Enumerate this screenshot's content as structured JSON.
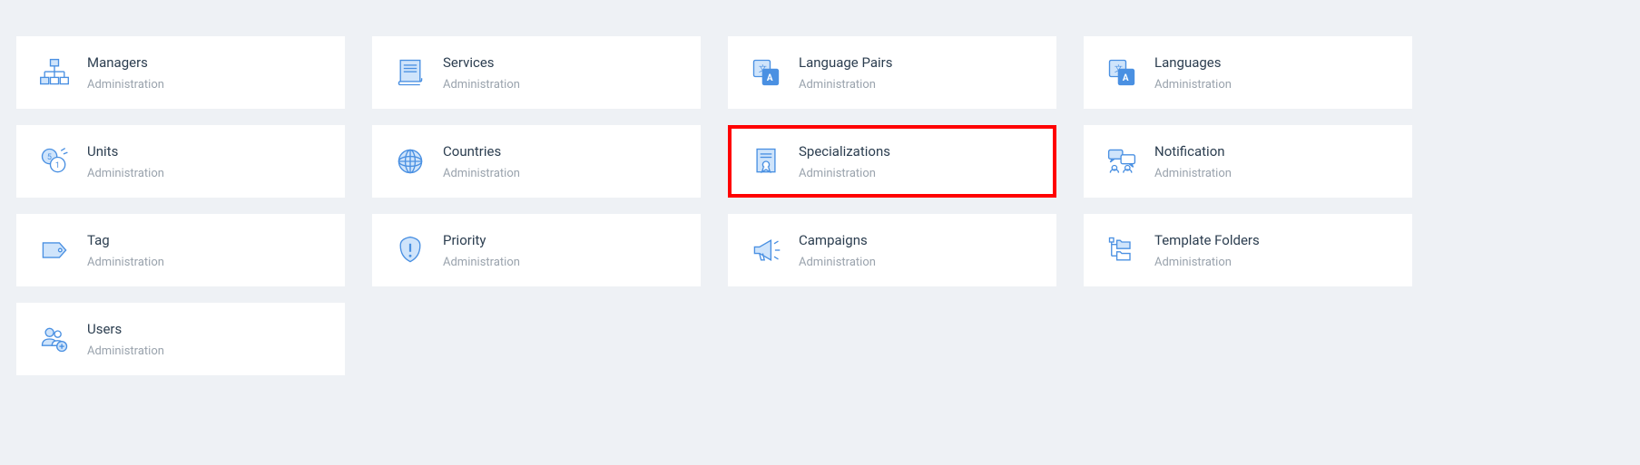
{
  "cards": [
    {
      "title": "Managers",
      "subtitle": "Administration",
      "icon": "managers",
      "highlight": false
    },
    {
      "title": "Services",
      "subtitle": "Administration",
      "icon": "services",
      "highlight": false
    },
    {
      "title": "Language Pairs",
      "subtitle": "Administration",
      "icon": "language-pairs",
      "highlight": false
    },
    {
      "title": "Languages",
      "subtitle": "Administration",
      "icon": "languages",
      "highlight": false
    },
    {
      "title": "Units",
      "subtitle": "Administration",
      "icon": "units",
      "highlight": false
    },
    {
      "title": "Countries",
      "subtitle": "Administration",
      "icon": "countries",
      "highlight": false
    },
    {
      "title": "Specializations",
      "subtitle": "Administration",
      "icon": "specializations",
      "highlight": true
    },
    {
      "title": "Notification",
      "subtitle": "Administration",
      "icon": "notification",
      "highlight": false
    },
    {
      "title": "Tag",
      "subtitle": "Administration",
      "icon": "tag",
      "highlight": false
    },
    {
      "title": "Priority",
      "subtitle": "Administration",
      "icon": "priority",
      "highlight": false
    },
    {
      "title": "Campaigns",
      "subtitle": "Administration",
      "icon": "campaigns",
      "highlight": false
    },
    {
      "title": "Template Folders",
      "subtitle": "Administration",
      "icon": "template-folders",
      "highlight": false
    },
    {
      "title": "Users",
      "subtitle": "Administration",
      "icon": "users",
      "highlight": false
    }
  ],
  "colors": {
    "iconStroke": "#4a90e2",
    "iconFill": "#cfe4fb",
    "highlight": "#ff0000"
  }
}
